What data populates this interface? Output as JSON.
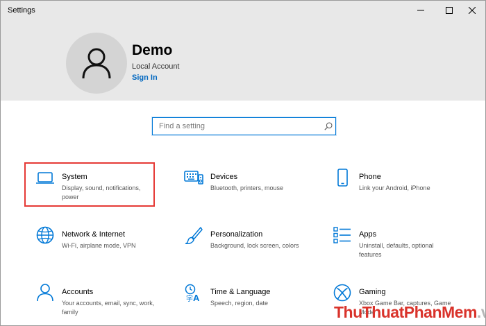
{
  "window": {
    "title": "Settings"
  },
  "profile": {
    "name": "Demo",
    "account_type": "Local Account",
    "sign_in_label": "Sign In"
  },
  "search": {
    "placeholder": "Find a setting"
  },
  "tiles": [
    {
      "name": "System",
      "description": "Display, sound, notifications, power",
      "icon": "laptop-icon",
      "highlighted": true
    },
    {
      "name": "Devices",
      "description": "Bluetooth, printers, mouse",
      "icon": "keyboard-icon",
      "highlighted": false
    },
    {
      "name": "Phone",
      "description": "Link your Android, iPhone",
      "icon": "phone-icon",
      "highlighted": false
    },
    {
      "name": "Network & Internet",
      "description": "Wi-Fi, airplane mode, VPN",
      "icon": "globe-icon",
      "highlighted": false
    },
    {
      "name": "Personalization",
      "description": "Background, lock screen, colors",
      "icon": "brush-icon",
      "highlighted": false
    },
    {
      "name": "Apps",
      "description": "Uninstall, defaults, optional features",
      "icon": "apps-list-icon",
      "highlighted": false
    },
    {
      "name": "Accounts",
      "description": "Your accounts, email, sync, work, family",
      "icon": "person-icon",
      "highlighted": false
    },
    {
      "name": "Time & Language",
      "description": "Speech, region, date",
      "icon": "time-language-icon",
      "highlighted": false
    },
    {
      "name": "Gaming",
      "description": "Xbox Game Bar, captures, Game Mode",
      "icon": "xbox-icon",
      "highlighted": false
    }
  ],
  "colors": {
    "accent": "#0078d7",
    "header_bg": "#e8e8e8",
    "highlight": "#e53935"
  },
  "watermark": {
    "part1": "Thu",
    "part2": "Thuat",
    "part3": "PhanMem",
    "part4": ".vn"
  }
}
